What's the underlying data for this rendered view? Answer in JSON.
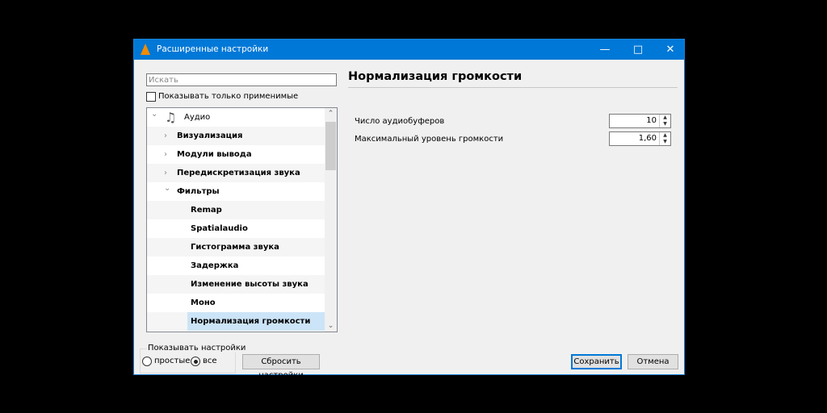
{
  "window": {
    "title": "Расширенные настройки",
    "controls": [
      "minimize",
      "maximize",
      "close"
    ]
  },
  "search": {
    "placeholder": "Искать",
    "value": ""
  },
  "show_applied_only": {
    "label": "Показывать только применимые",
    "checked": false
  },
  "tree": {
    "items": [
      {
        "label": "Аудио",
        "level": 0,
        "expanded": true,
        "icon": "music-note-gear-icon"
      },
      {
        "label": "Визуализация",
        "level": 1,
        "expanded": false
      },
      {
        "label": "Модули вывода",
        "level": 1,
        "expanded": false
      },
      {
        "label": "Передискретизация звука",
        "level": 1,
        "expanded": false
      },
      {
        "label": "Фильтры",
        "level": 1,
        "expanded": true
      },
      {
        "label": "Remap",
        "level": 2
      },
      {
        "label": "Spatialaudio",
        "level": 2
      },
      {
        "label": "Гистограмма звука",
        "level": 2
      },
      {
        "label": "Задержка",
        "level": 2
      },
      {
        "label": "Изменение высоты звука",
        "level": 2
      },
      {
        "label": "Моно",
        "level": 2
      },
      {
        "label": "Нормализация громкости",
        "level": 2,
        "selected": true
      }
    ]
  },
  "panel": {
    "title": "Нормализация громкости",
    "settings": [
      {
        "label": "Число аудиобуферов",
        "value": "10"
      },
      {
        "label": "Максимальный уровень громкости",
        "value": "1,60"
      }
    ]
  },
  "show_settings": {
    "label": "Показывать настройки",
    "options": [
      {
        "label": "простые",
        "selected": false
      },
      {
        "label": "все",
        "selected": true
      }
    ]
  },
  "buttons": {
    "reset": "Сбросить настройки",
    "save": "Сохранить",
    "cancel": "Отмена"
  }
}
